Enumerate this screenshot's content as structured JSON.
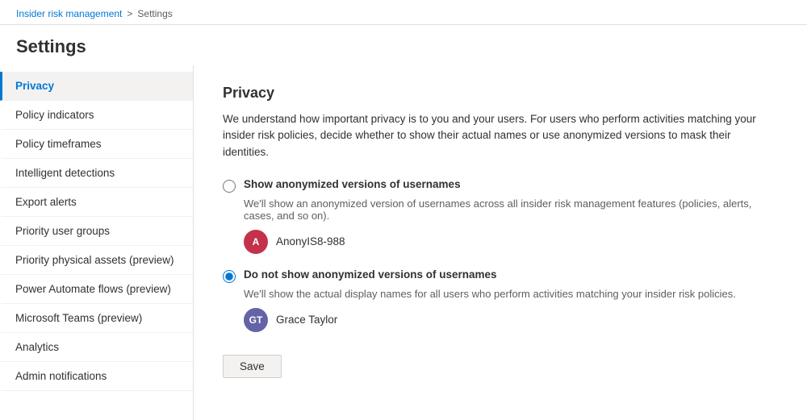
{
  "breadcrumb": {
    "parent": "Insider risk management",
    "separator": ">",
    "current": "Settings"
  },
  "page_title": "Settings",
  "sidebar": {
    "items": [
      {
        "id": "privacy",
        "label": "Privacy",
        "active": true
      },
      {
        "id": "policy-indicators",
        "label": "Policy indicators",
        "active": false
      },
      {
        "id": "policy-timeframes",
        "label": "Policy timeframes",
        "active": false
      },
      {
        "id": "intelligent-detections",
        "label": "Intelligent detections",
        "active": false
      },
      {
        "id": "export-alerts",
        "label": "Export alerts",
        "active": false
      },
      {
        "id": "priority-user-groups",
        "label": "Priority user groups",
        "active": false
      },
      {
        "id": "priority-physical-assets",
        "label": "Priority physical assets (preview)",
        "active": false
      },
      {
        "id": "power-automate-flows",
        "label": "Power Automate flows (preview)",
        "active": false
      },
      {
        "id": "microsoft-teams",
        "label": "Microsoft Teams (preview)",
        "active": false
      },
      {
        "id": "analytics",
        "label": "Analytics",
        "active": false
      },
      {
        "id": "admin-notifications",
        "label": "Admin notifications",
        "active": false
      }
    ]
  },
  "content": {
    "title": "Privacy",
    "description": "We understand how important privacy is to you and your users. For users who perform activities matching your insider risk policies, decide whether to show their actual names or use anonymized versions to mask their identities.",
    "options": [
      {
        "id": "show-anonymized",
        "label": "Show anonymized versions of usernames",
        "description": "We'll show an anonymized version of usernames across all insider risk management features (policies, alerts, cases, and so on).",
        "checked": false,
        "user": {
          "initials": "A",
          "name": "AnonyIS8-988",
          "avatar_color": "#c4314b",
          "avatar_class": "avatar-red"
        }
      },
      {
        "id": "do-not-show-anonymized",
        "label": "Do not show anonymized versions of usernames",
        "description": "We'll show the actual display names for all users who perform activities matching your insider risk policies.",
        "checked": true,
        "user": {
          "initials": "GT",
          "name": "Grace Taylor",
          "avatar_color": "#6264a7",
          "avatar_class": "avatar-purple"
        }
      }
    ],
    "save_button": "Save"
  }
}
